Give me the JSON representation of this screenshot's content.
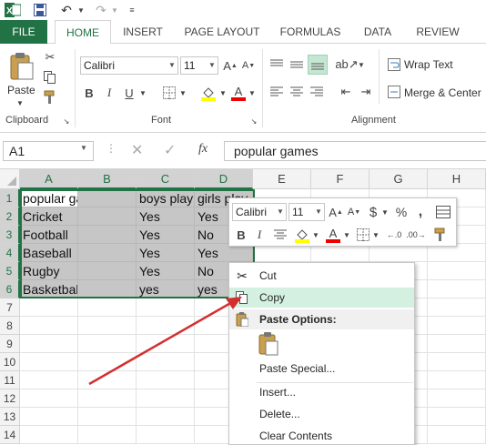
{
  "tabs": [
    {
      "label": "FILE"
    },
    {
      "label": "HOME"
    },
    {
      "label": "INSERT"
    },
    {
      "label": "PAGE LAYOUT"
    },
    {
      "label": "FORMULAS"
    },
    {
      "label": "DATA"
    },
    {
      "label": "REVIEW"
    }
  ],
  "ribbon": {
    "clipboard": {
      "label": "Clipboard",
      "paste_label": "Paste"
    },
    "font": {
      "label": "Font",
      "font_name": "Calibri",
      "font_size": "11"
    },
    "alignment": {
      "label": "Alignment",
      "wrap_text": "Wrap Text",
      "merge_center": "Merge & Center"
    }
  },
  "formula_bar": {
    "name_box": "A1",
    "fx": "fx",
    "content": "popular games"
  },
  "columns": [
    "A",
    "B",
    "C",
    "D",
    "E",
    "F",
    "G",
    "H"
  ],
  "rows": [
    "1",
    "2",
    "3",
    "4",
    "5",
    "6",
    "7",
    "8",
    "9",
    "10",
    "11",
    "12",
    "13",
    "14"
  ],
  "cells": {
    "A1": "popular games",
    "C1": "boys play",
    "D1": "girls play",
    "A2": "Cricket",
    "C2": "Yes",
    "D2": "Yes",
    "A3": "Football",
    "C3": "Yes",
    "D3": "No",
    "A4": "Baseball",
    "C4": "Yes",
    "D4": "Yes",
    "A5": "Rugby",
    "C5": "Yes",
    "D5": "No",
    "A6": "Basketball",
    "C6": "yes",
    "D6": "yes"
  },
  "mini_toolbar": {
    "font_name": "Calibri",
    "font_size": "11"
  },
  "context_menu": {
    "cut": "Cut",
    "copy": "Copy",
    "paste_options": "Paste Options:",
    "paste_special": "Paste Special...",
    "insert": "Insert...",
    "delete": "Delete...",
    "clear_contents": "Clear Contents"
  },
  "colors": {
    "excel_green": "#217346",
    "arrow_red": "#d32f2f",
    "hover_green": "#d3f0e0",
    "selection_gray": "#c6c6c6"
  }
}
